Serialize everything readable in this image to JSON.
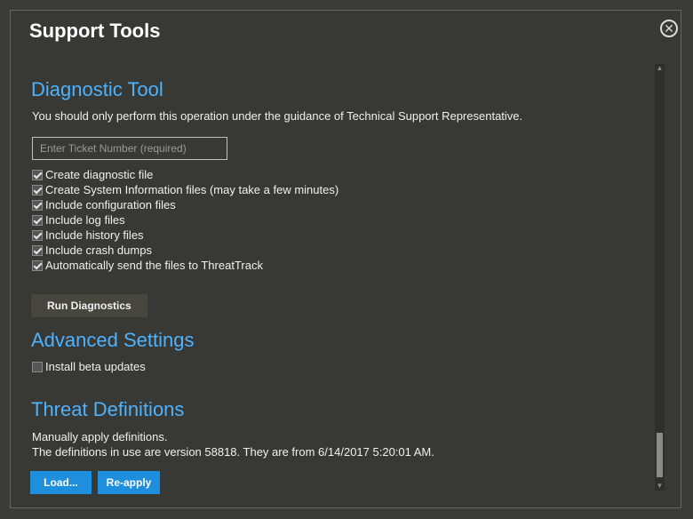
{
  "dialog": {
    "title": "Support Tools",
    "close_icon": "close-icon"
  },
  "diagnostic": {
    "title": "Diagnostic Tool",
    "description": "You should only perform this operation under the guidance of Technical Support Representative.",
    "ticket_placeholder": "Enter Ticket Number (required)",
    "ticket_value": "",
    "options": [
      {
        "label": "Create diagnostic file",
        "checked": true
      },
      {
        "label": "Create System Information files (may take a few minutes)",
        "checked": true
      },
      {
        "label": "Include configuration files",
        "checked": true
      },
      {
        "label": "Include log files",
        "checked": true
      },
      {
        "label": "Include history files",
        "checked": true
      },
      {
        "label": "Include crash dumps",
        "checked": true
      },
      {
        "label": "Automatically send the files to ThreatTrack",
        "checked": true
      }
    ],
    "run_button": "Run Diagnostics"
  },
  "advanced": {
    "title": "Advanced Settings",
    "beta_label": "Install beta updates",
    "beta_checked": false
  },
  "threat": {
    "title": "Threat Definitions",
    "line1": "Manually apply definitions.",
    "line2": "The definitions in use are version 58818.  They are from 6/14/2017 5:20:01 AM.",
    "load_button": "Load...",
    "reapply_button": "Re-apply"
  },
  "colors": {
    "accent": "#4db3ff",
    "button_blue": "#1e8fdc",
    "background": "#383834"
  }
}
